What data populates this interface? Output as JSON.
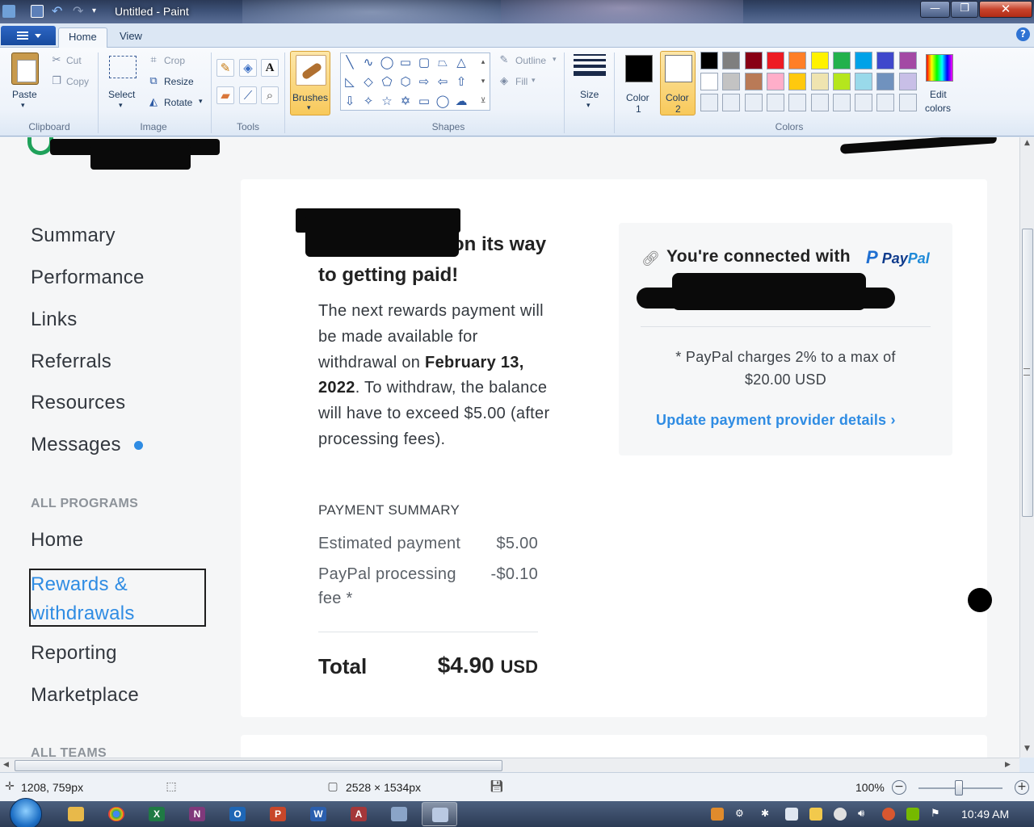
{
  "window": {
    "title": "Untitled - Paint",
    "minimize": "—",
    "maximize": "❐",
    "close": "✕"
  },
  "ribbon": {
    "tabs": [
      {
        "label": "Home"
      },
      {
        "label": "View"
      }
    ],
    "clipboard": {
      "group": "Clipboard",
      "paste": "Paste",
      "cut": "Cut",
      "copy": "Copy"
    },
    "image": {
      "group": "Image",
      "select": "Select",
      "crop": "Crop",
      "resize": "Resize",
      "rotate": "Rotate"
    },
    "tools": {
      "group": "Tools"
    },
    "brushes": {
      "label": "Brushes"
    },
    "shapes": {
      "group": "Shapes",
      "outline": "Outline",
      "fill": "Fill"
    },
    "size": {
      "label": "Size"
    },
    "colors": {
      "group": "Colors",
      "color1_label": "Color",
      "color1_num": "1",
      "color2_label": "Color",
      "color2_num": "2",
      "edit_label": "Edit",
      "edit_label2": "colors",
      "color1": "#000000",
      "color2": "#ffffff",
      "palette_row1": [
        "#000000",
        "#7f7f7f",
        "#880015",
        "#ed1c24",
        "#ff7f27",
        "#fff200",
        "#22b14c",
        "#00a2e8",
        "#3f48cc",
        "#a349a4"
      ],
      "palette_row2": [
        "#ffffff",
        "#c3c3c3",
        "#b97a57",
        "#ffaec9",
        "#ffc90e",
        "#efe4b0",
        "#b5e61d",
        "#99d9ea",
        "#7092be",
        "#c8bfe7"
      ]
    }
  },
  "page": {
    "sidebar": {
      "items": [
        {
          "label": "Summary"
        },
        {
          "label": "Performance"
        },
        {
          "label": "Links"
        },
        {
          "label": "Referrals"
        },
        {
          "label": "Resources"
        },
        {
          "label": "Messages"
        }
      ],
      "section_programs": "ALL PROGRAMS",
      "program_items": [
        {
          "label": "Home"
        },
        {
          "label": "Rewards & withdrawals"
        },
        {
          "label": "Reporting"
        },
        {
          "label": "Marketplace"
        }
      ],
      "section_teams": "ALL TEAMS"
    },
    "main": {
      "headline_visible": "s on its way to getting paid!",
      "intro_part1": "The next rewards payment will be made available for withdrawal on ",
      "intro_date": "February 13, 2022",
      "intro_part2": ". To withdraw, the balance will have to exceed $5.00 (after processing fees).",
      "summary_title": "PAYMENT SUMMARY",
      "estimated_label": "Estimated payment",
      "estimated_value": "$5.00",
      "fee_label": "PayPal processing fee *",
      "fee_value": "-$0.10",
      "total_label": "Total",
      "total_amount": "$4.90",
      "total_currency": "USD"
    },
    "paypal": {
      "connected_text": "You're connected with",
      "logo_text_pay": "Pay",
      "logo_text_pal": "Pal",
      "note": "* PayPal charges 2% to a max of $20.00 USD",
      "update_link": "Update payment provider details"
    }
  },
  "statusbar": {
    "cursor_pos": "1208, 759px",
    "image_size": "2528 × 1534px",
    "zoom": "100%"
  },
  "taskbar": {
    "clock": "10:49 AM"
  }
}
